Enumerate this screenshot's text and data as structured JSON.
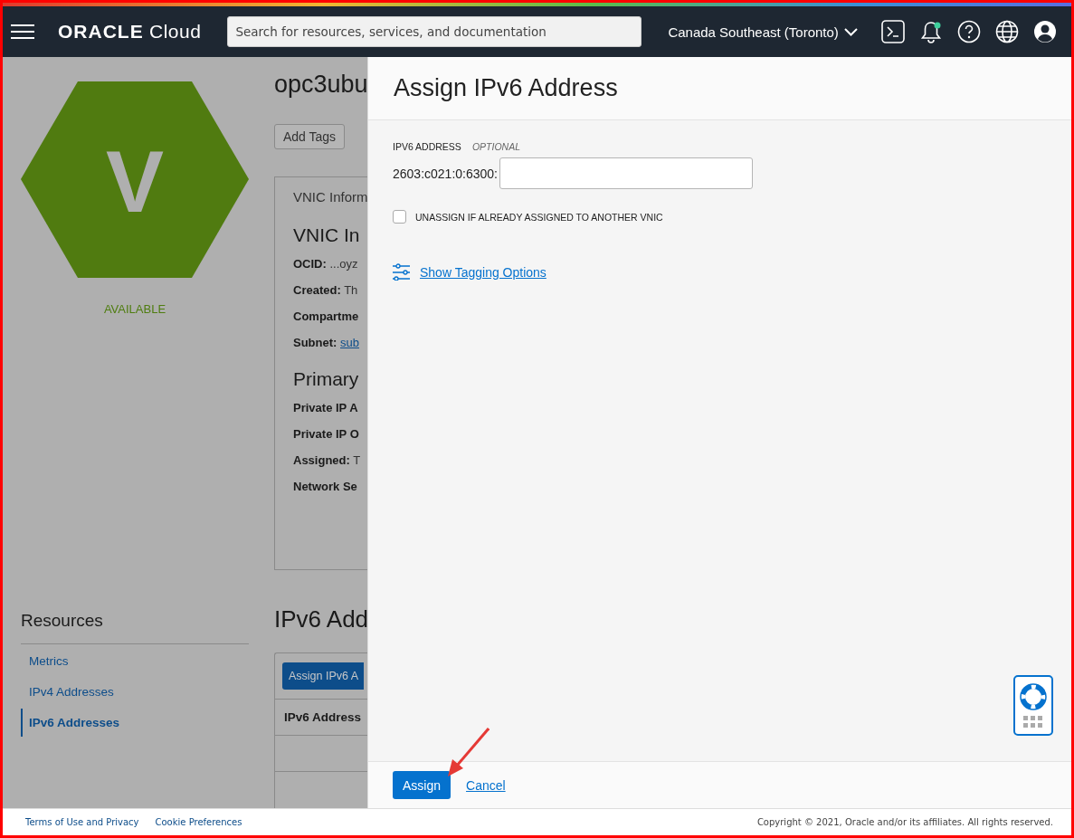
{
  "header": {
    "logo_brand": "ORACLE",
    "logo_product": "Cloud",
    "search": {
      "placeholder": "Search for resources, services, and documentation"
    },
    "region": "Canada Southeast (Toronto)",
    "notifications_unread": true
  },
  "background_page": {
    "status": {
      "letter": "V",
      "label": "AVAILABLE"
    },
    "title": "opc3ubu",
    "add_tags": "Add Tags",
    "vnic_card": {
      "tab": "VNIC Inform",
      "sections": [
        {
          "heading": "VNIC In",
          "fields": [
            {
              "label": "OCID:",
              "value": "...oyz",
              "kind": "text"
            },
            {
              "label": "Created:",
              "value": "Th",
              "kind": "text"
            },
            {
              "label": "Compartme"
            },
            {
              "label": "Subnet:",
              "value": "sub",
              "kind": "link"
            }
          ]
        },
        {
          "heading": "Primary",
          "fields": [
            {
              "label": "Private IP A"
            },
            {
              "label": "Private IP O"
            },
            {
              "label": "Assigned:",
              "value": "T",
              "kind": "text"
            },
            {
              "label": "Network Se"
            }
          ]
        }
      ]
    },
    "resources": {
      "heading": "Resources",
      "items": [
        {
          "label": "Metrics",
          "selected": false
        },
        {
          "label": "IPv4 Addresses",
          "selected": false
        },
        {
          "label": "IPv6 Addresses",
          "selected": true
        }
      ]
    },
    "ipv6_section": {
      "heading": "IPv6 Add",
      "button": "Assign IPv6 A",
      "columns": [
        "IPv6 Address"
      ]
    }
  },
  "panel": {
    "title": "Assign IPv6 Address",
    "field": {
      "label": "IPV6 ADDRESS",
      "optional": "OPTIONAL",
      "prefix": "2603:c021:0:6300:"
    },
    "checkbox": {
      "label": "UNASSIGN IF ALREADY ASSIGNED TO ANOTHER VNIC",
      "checked": false
    },
    "tagging_link": "Show Tagging Options",
    "buttons": {
      "primary": "Assign",
      "cancel": "Cancel"
    }
  },
  "footer": {
    "links": [
      "Terms of Use and Privacy",
      "Cookie Preferences"
    ],
    "copyright": "Copyright © 2021, Oracle and/or its affiliates. All rights reserved."
  }
}
